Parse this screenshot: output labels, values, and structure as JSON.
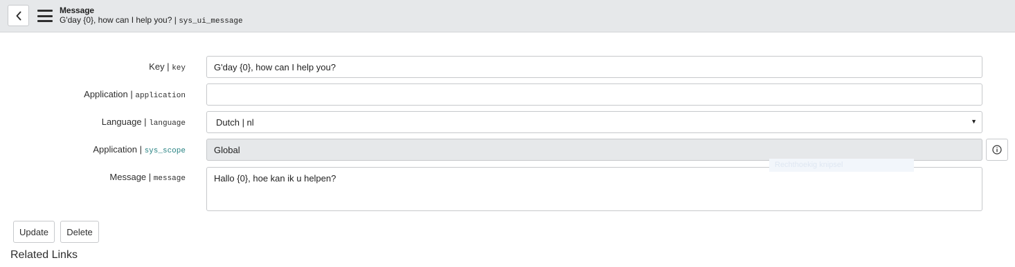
{
  "header": {
    "title": "Message",
    "subtitle_text": "G'day {0}, how can I help you? |",
    "subtitle_table": "sys_ui_message"
  },
  "form": {
    "key": {
      "label": "Key |",
      "field_name": "key",
      "value": "G'day {0}, how can I help you?"
    },
    "application": {
      "label": "Application |",
      "field_name": "application",
      "value": ""
    },
    "language": {
      "label": "Language |",
      "field_name": "language",
      "selected": "Dutch | nl"
    },
    "scope": {
      "label": "Application |",
      "field_name": "sys_scope",
      "value": "Global"
    },
    "message": {
      "label": "Message |",
      "field_name": "message",
      "value": "Hallo {0}, hoe kan ik u helpen?"
    }
  },
  "overlay": {
    "ghost_text": "Rechthoekig knipsel"
  },
  "buttons": {
    "update": "Update",
    "delete": "Delete"
  },
  "related_links": "Related Links",
  "icons": {
    "back": "chevron-left-icon",
    "menu": "hamburger-menu-icon",
    "info": "info-circle-icon",
    "dropdown": "triangle-down-icon"
  },
  "colors": {
    "header_bg": "#e6e8ea",
    "readonly_bg": "#e6e8ea",
    "scope_field_name": "#278282"
  }
}
